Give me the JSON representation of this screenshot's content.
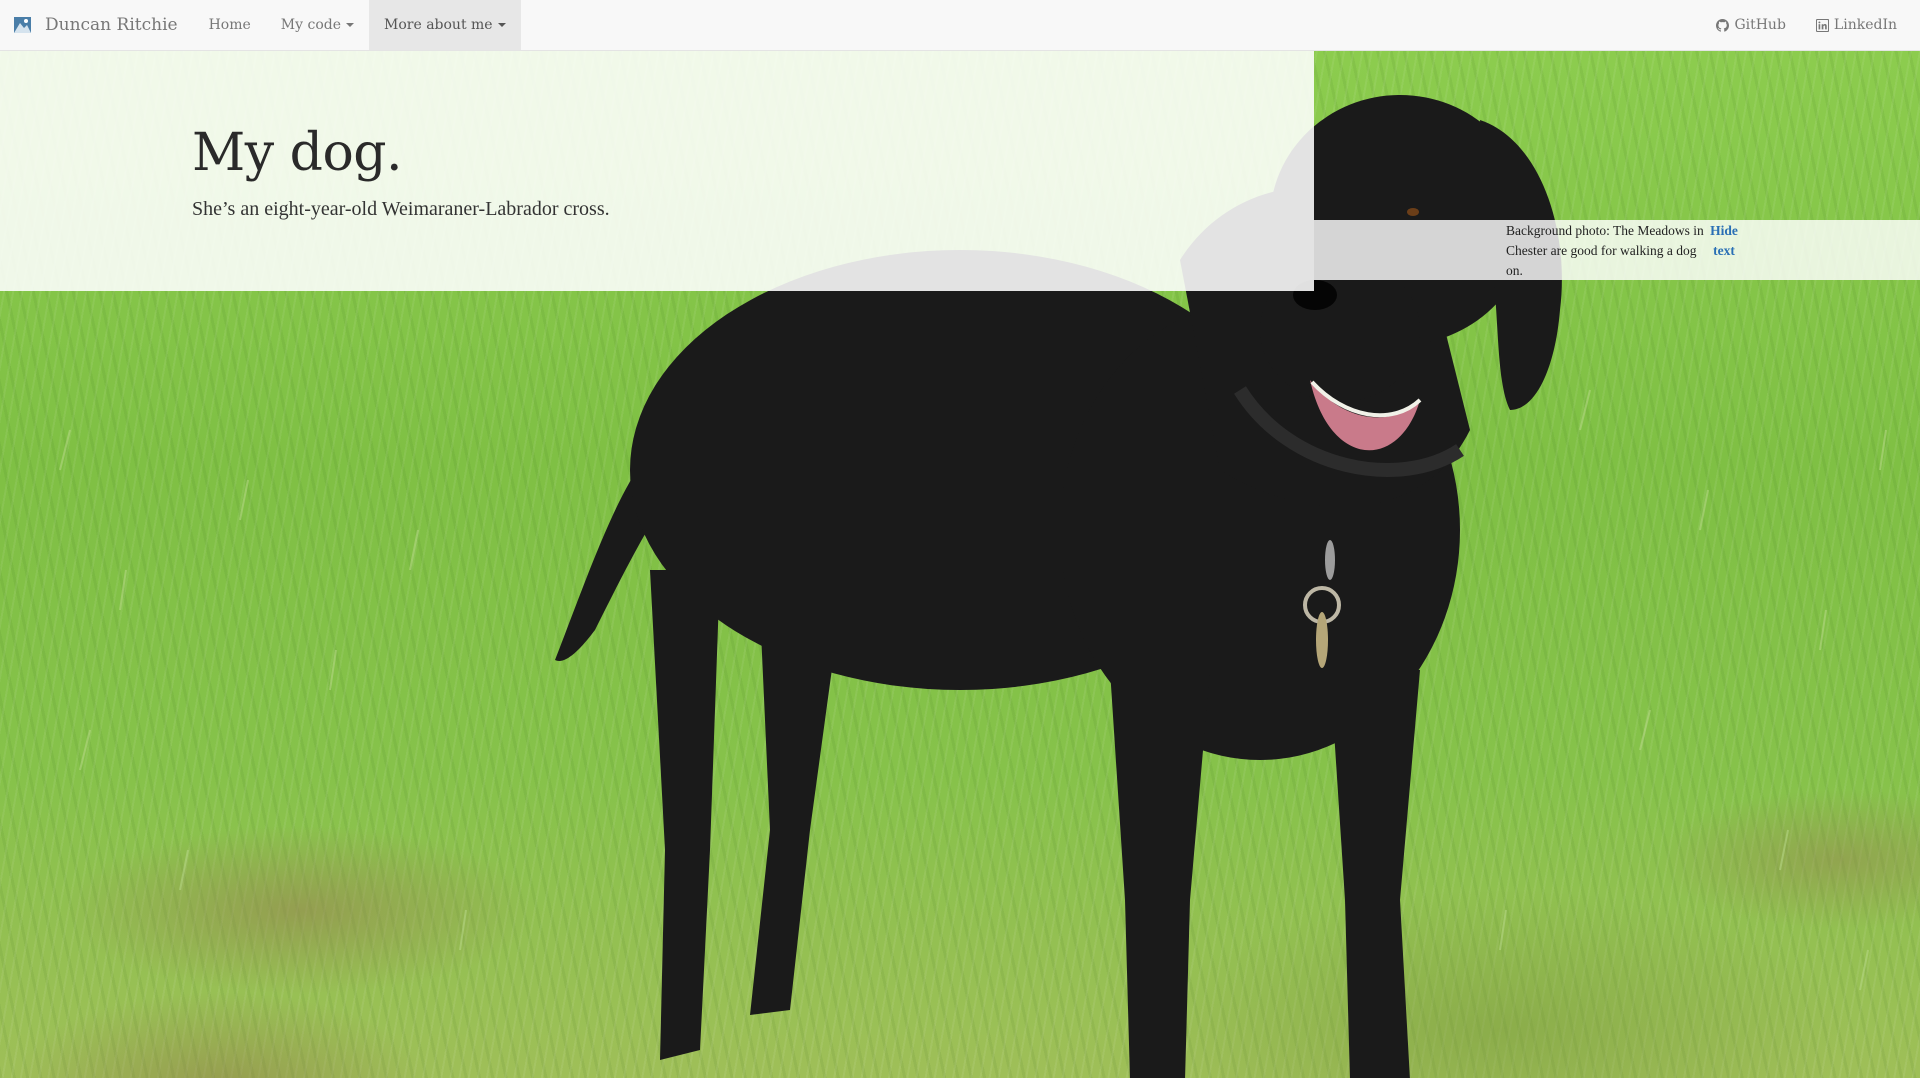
{
  "navbar": {
    "brand": "Duncan Ritchie",
    "items": [
      {
        "label": "Home",
        "dropdown": false,
        "active": false
      },
      {
        "label": "My code",
        "dropdown": true,
        "active": false
      },
      {
        "label": "More about me",
        "dropdown": true,
        "active": true
      }
    ],
    "right_items": [
      {
        "label": "GitHub",
        "icon": "github-icon"
      },
      {
        "label": "LinkedIn",
        "icon": "linkedin-icon"
      }
    ]
  },
  "hero": {
    "title": "My dog.",
    "subtitle": "She’s an eight-year-old Weimaraner-Labrador cross."
  },
  "photo_caption": {
    "text": "Background photo: The Meadows in Chester are good for walking a dog on.",
    "hide_link_label": "Hide text"
  },
  "colors": {
    "navbar_bg": "#f8f8f8",
    "link": "#2a6fb5",
    "grass": "#86c24a",
    "dog": "#141414"
  }
}
